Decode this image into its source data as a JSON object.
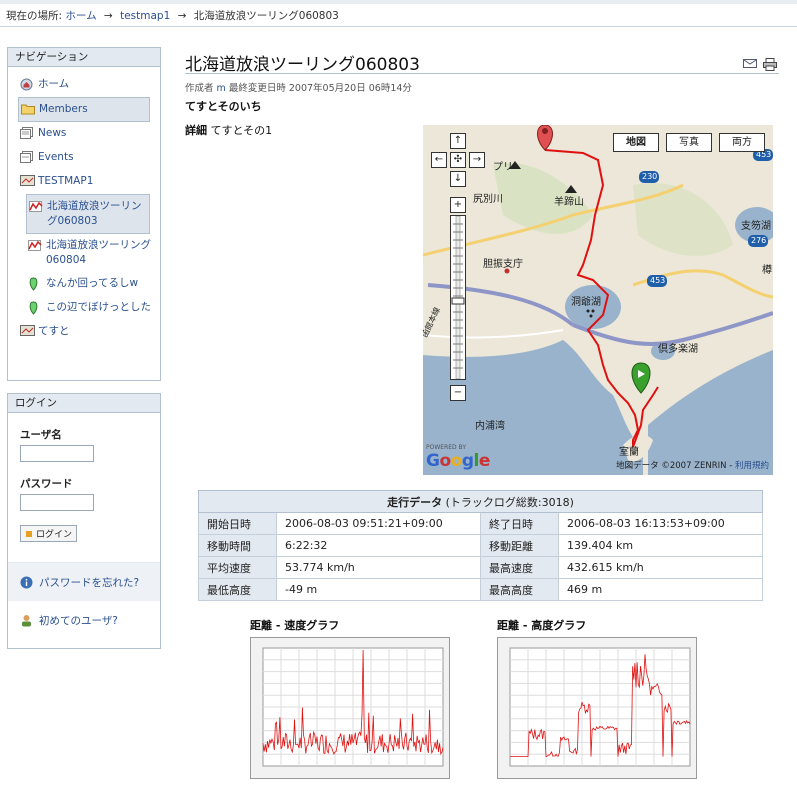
{
  "breadcrumb": {
    "prefix": "現在の場所:",
    "items": [
      "ホーム",
      "testmap1",
      "北海道放浪ツーリング060803"
    ],
    "separator": "→"
  },
  "navigation": {
    "title": "ナビゲーション",
    "items": [
      {
        "label": "ホーム",
        "icon": "home-icon",
        "active": false,
        "sub": false
      },
      {
        "label": "Members",
        "icon": "folder-icon",
        "active": true,
        "sub": false
      },
      {
        "label": "News",
        "icon": "news-icon",
        "active": false,
        "sub": false
      },
      {
        "label": "Events",
        "icon": "events-icon",
        "active": false,
        "sub": false
      },
      {
        "label": "TESTMAP1",
        "icon": "map-icon",
        "active": false,
        "sub": false
      },
      {
        "label": "北海道放浪ツーリング060803",
        "icon": "track-icon",
        "active": true,
        "sub": true
      },
      {
        "label": "北海道放浪ツーリング060804",
        "icon": "track-icon",
        "active": false,
        "sub": true
      },
      {
        "label": "なんか回ってるしw",
        "icon": "pin-icon",
        "active": false,
        "sub": true
      },
      {
        "label": "この辺でぼけっとした",
        "icon": "pin-icon",
        "active": false,
        "sub": true
      },
      {
        "label": "てすと",
        "icon": "map-icon",
        "active": false,
        "sub": false
      }
    ]
  },
  "login": {
    "title": "ログイン",
    "username_label": "ユーザ名",
    "password_label": "パスワード",
    "button_label": "ログイン",
    "forgot_label": "パスワードを忘れた?",
    "new_user_label": "初めてのユーザ?"
  },
  "page": {
    "title": "北海道放浪ツーリング060803",
    "meta_prefix": "作成者",
    "meta_author": "m",
    "meta_suffix": "最終変更日時 2007年05月20日 06時14分",
    "subtitle": "てすとそのいち",
    "detail_label": "詳細",
    "detail_text": "てすとその1"
  },
  "map": {
    "types": [
      "地図",
      "写真",
      "両方"
    ],
    "selected_type": "地図",
    "labels": {
      "a": "プリ",
      "b": "尻別川",
      "c": "羊蹄山",
      "d": "胆振支庁",
      "e": "洞爺湖",
      "f": "倶多楽湖",
      "g": "内浦湾",
      "h": "室蘭",
      "i": "支笏湖",
      "j": "樽",
      "k": "函館本線"
    },
    "roads": [
      "453",
      "230",
      "276",
      "453"
    ],
    "powered_by": "POWERED BY",
    "google": "Google",
    "copyright": "地図データ ©2007 ZENRIN - ",
    "terms": "利用規約"
  },
  "stats": {
    "title": "走行データ",
    "title_suffix": "(トラックログ総数:3018)",
    "rows": [
      {
        "k1": "開始日時",
        "v1": "2006-08-03 09:51:21+09:00",
        "k2": "終了日時",
        "v2": "2006-08-03 16:13:53+09:00"
      },
      {
        "k1": "移動時間",
        "v1": "6:22:32",
        "k2": "移動距離",
        "v2": "139.404 km"
      },
      {
        "k1": "平均速度",
        "v1": "53.774 km/h",
        "k2": "最高速度",
        "v2": "432.615 km/h"
      },
      {
        "k1": "最低高度",
        "v1": "-49 m",
        "k2": "最高高度",
        "v2": "469 m"
      }
    ]
  },
  "graphs": {
    "speed_title": "距離 - 速度グラフ",
    "altitude_title": "距離 - 高度グラフ"
  },
  "colors": {
    "route": "#e01010",
    "accent": "#2a4f8f",
    "panel_head": "#e3e9f0"
  }
}
